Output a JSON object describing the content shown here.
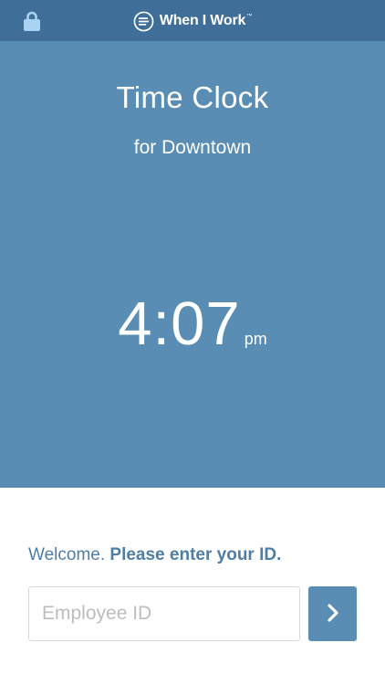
{
  "header": {
    "brand_name": "When I Work",
    "brand_mark": "™",
    "lock_icon": "lock-icon",
    "logo_icon": "when-i-work-logo-icon",
    "bar_color": "#3f6e98"
  },
  "clock": {
    "title": "Time Clock",
    "location": "for Downtown",
    "time": "4:07",
    "meridiem": "pm",
    "background_color": "#5a8db4"
  },
  "form": {
    "welcome_prefix": "Welcome.",
    "welcome_instruction": "Please enter your ID.",
    "employee_id_value": "",
    "employee_id_placeholder": "Employee ID",
    "submit_icon": "chevron-right-icon",
    "accent_color": "#5a8db4"
  }
}
